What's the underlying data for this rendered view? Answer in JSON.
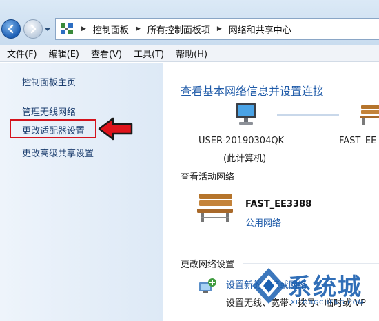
{
  "breadcrumb": [
    "控制面板",
    "所有控制面板项",
    "网络和共享中心"
  ],
  "menu": [
    "文件(F)",
    "编辑(E)",
    "查看(V)",
    "工具(T)",
    "帮助(H)"
  ],
  "sidebar": {
    "items": [
      {
        "label": "控制面板主页"
      },
      {
        "label": "管理无线网络"
      },
      {
        "label": "更改适配器设置",
        "highlighted": true
      },
      {
        "label": "更改高级共享设置"
      }
    ]
  },
  "main": {
    "title": "查看基本网络信息并设置连接",
    "computer_name": "USER-20190304QK",
    "computer_caption": "(此计算机)",
    "network_node_name": "FAST_EE",
    "active_networks_heading": "查看活动网络",
    "active_network": {
      "name": "FAST_EE3388",
      "type": "公用网络"
    },
    "change_settings_heading": "更改网络设置",
    "setup_link": "设置新的连接或网络",
    "setup_desc": "设置无线、宽带、拨号、临时或 VP"
  },
  "watermark": {
    "text": "系统城",
    "sub": "XITONGCHENG.COM"
  },
  "colors": {
    "link": "#1e5aa8",
    "highlight_red": "#d4131c",
    "pane_bg": "#dde9f6"
  }
}
